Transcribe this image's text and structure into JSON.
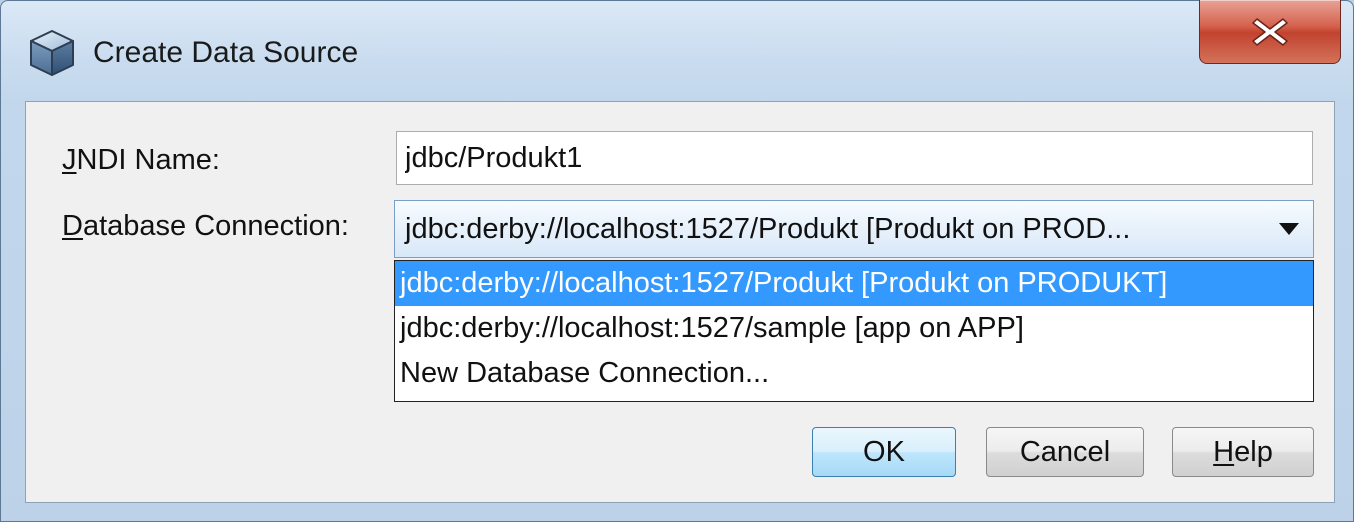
{
  "window": {
    "title": "Create Data Source",
    "icon": "cube-icon",
    "close_icon": "close-icon"
  },
  "form": {
    "jndi_label_accesskey": "J",
    "jndi_label_rest": "NDI Name:",
    "jndi_value": "jdbc/Produkt1",
    "db_label_accesskey": "D",
    "db_label_rest": "atabase Connection:",
    "db_selected": "jdbc:derby://localhost:1527/Produkt [Produkt on PROD...",
    "db_options": [
      "jdbc:derby://localhost:1527/Produkt [Produkt on PRODUKT]",
      "jdbc:derby://localhost:1527/sample [app on APP]",
      "New Database Connection..."
    ],
    "highlighted_option_index": 0
  },
  "buttons": {
    "ok": "OK",
    "cancel": "Cancel",
    "help_accesskey": "H",
    "help_rest": "elp"
  },
  "colors": {
    "selection": "#3399ff",
    "close_button": "#c9503b",
    "frame": "#c3d7ec"
  }
}
